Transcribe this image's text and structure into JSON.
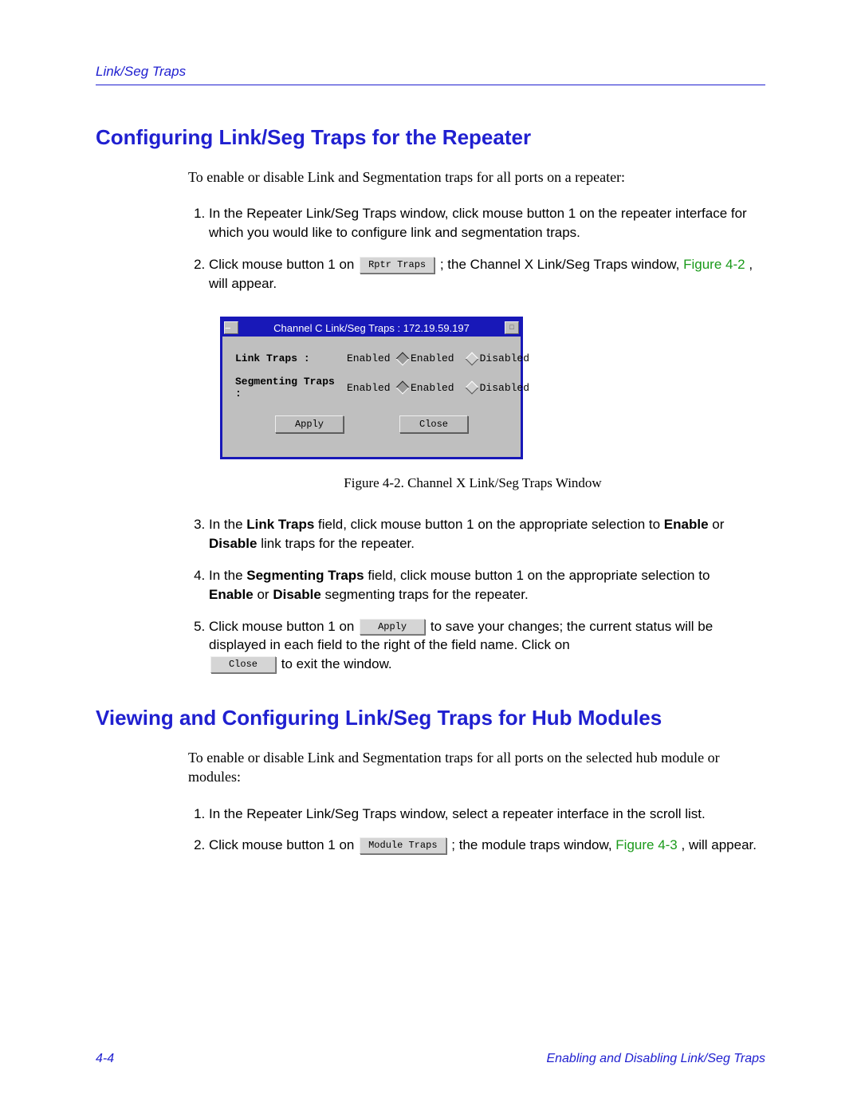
{
  "header": {
    "section": "Link/Seg Traps"
  },
  "h1": "Configuring Link/Seg Traps for the Repeater",
  "intro1": "To enable or disable Link and Segmentation traps for all ports on a repeater:",
  "steps1": {
    "s1": "In the Repeater Link/Seg Traps window, click mouse button 1 on the repeater interface for which you would like to configure link and segmentation traps.",
    "s2a": "Click mouse button 1 on ",
    "s2btn": "Rptr Traps",
    "s2b": " ; the Channel X Link/Seg Traps window, ",
    "s2fig": "Figure 4-2",
    "s2c": ", will appear."
  },
  "dialog": {
    "title": "Channel C Link/Seg Traps : 172.19.59.197",
    "row1": {
      "label": "Link Traps :",
      "status": "Enabled",
      "opt1": "Enabled",
      "opt2": "Disabled"
    },
    "row2": {
      "label": "Segmenting Traps :",
      "status": "Enabled",
      "opt1": "Enabled",
      "opt2": "Disabled"
    },
    "btnApply": "Apply",
    "btnClose": "Close"
  },
  "figcap": "Figure 4-2. Channel X Link/Seg Traps Window",
  "steps2": {
    "s3a": "In the ",
    "s3b": "Link Traps",
    "s3c": " field, click mouse button 1 on the appropriate selection to ",
    "s3d": "Enable",
    "s3e": " or ",
    "s3f": "Disable",
    "s3g": " link traps for the repeater.",
    "s4a": "In the ",
    "s4b": "Segmenting Traps",
    "s4c": " field, click mouse button 1 on the appropriate selection to ",
    "s4d": "Enable",
    "s4e": " or ",
    "s4f": "Disable",
    "s4g": " segmenting traps for the repeater.",
    "s5a": "Click mouse button 1 on ",
    "s5btn1": "Apply",
    "s5b": " to save your changes; the current status will be displayed in each field to the right of the field name. Click on ",
    "s5btn2": "Close",
    "s5c": " to exit the window."
  },
  "h2": "Viewing and Configuring Link/Seg Traps for Hub Modules",
  "intro2": "To enable or disable Link and Segmentation traps for all ports on the selected hub module or modules:",
  "steps3": {
    "s1": "In the Repeater Link/Seg Traps window, select a repeater interface in the scroll list.",
    "s2a": "Click mouse button 1 on ",
    "s2btn": "Module Traps",
    "s2b": " ; the module traps window, ",
    "s2fig": "Figure 4-3",
    "s2c": ", will appear."
  },
  "footer": {
    "left": "4-4",
    "right": "Enabling and Disabling Link/Seg Traps"
  }
}
